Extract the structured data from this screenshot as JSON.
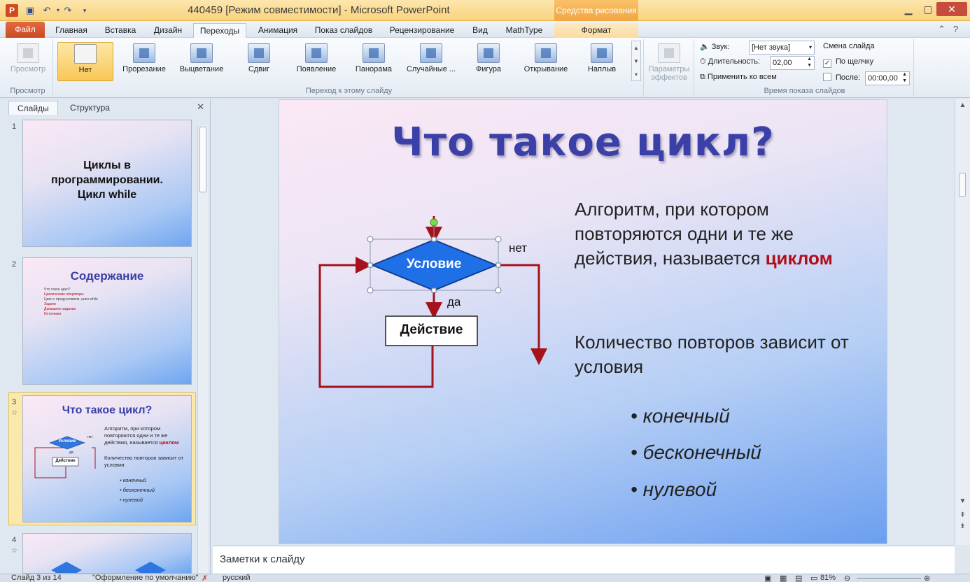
{
  "window": {
    "title": "440459 [Режим совместимости] - Microsoft PowerPoint",
    "context_tab": "Средства рисования"
  },
  "tabs": [
    "Файл",
    "Главная",
    "Вставка",
    "Дизайн",
    "Переходы",
    "Анимация",
    "Показ слайдов",
    "Рецензирование",
    "Вид",
    "MathType",
    "Формат"
  ],
  "ribbon": {
    "preview": {
      "label": "Просмотр",
      "group": "Просмотр"
    },
    "transitions": {
      "group": "Переход к этому слайду",
      "items": [
        "Нет",
        "Прорезание",
        "Выцветание",
        "Сдвиг",
        "Появление",
        "Панорама",
        "Случайные ...",
        "Фигура",
        "Открывание",
        "Наплыв"
      ]
    },
    "effects": {
      "line1": "Параметры",
      "line2": "эффектов"
    },
    "timing": {
      "group": "Время показа слайдов",
      "sound_label": "Звук:",
      "sound_value": "[Нет звука]",
      "duration_label": "Длительность:",
      "duration_value": "02,00",
      "apply_all": "Применить ко всем",
      "advance": "Смена слайда",
      "on_click": "По щелчку",
      "after": "После:",
      "after_value": "00:00,00"
    }
  },
  "panel": {
    "tabs": [
      "Слайды",
      "Структура"
    ],
    "thumbs": [
      {
        "num": "1",
        "title": "Циклы в программировании. Цикл while"
      },
      {
        "num": "2",
        "title": "Содержание",
        "items": [
          "Что такое цикл?",
          "Циклические операторы",
          "Цикл с предусловием, цикл while",
          "Задачи",
          "Домашнее задание",
          "Источники"
        ]
      },
      {
        "num": "3",
        "title": "Что такое цикл?"
      },
      {
        "num": "4"
      }
    ]
  },
  "slide": {
    "title": "Что такое цикл?",
    "para1": "Алгоритм, при котором повторяются одни и те же действия, называется",
    "para1_red": "циклом",
    "para2": "Количество повторов зависит от условия",
    "bullets": [
      "• конечный",
      "• бесконечный",
      "• нулевой"
    ],
    "flow": {
      "condition": "Условие",
      "action": "Действие",
      "no": "нет",
      "yes": "да"
    }
  },
  "notes": {
    "placeholder": "Заметки к слайду"
  },
  "status": {
    "slide": "Слайд 3 из 14",
    "theme": "\"Оформление по умолчанию\"",
    "lang": "русский",
    "zoom": "81%"
  }
}
